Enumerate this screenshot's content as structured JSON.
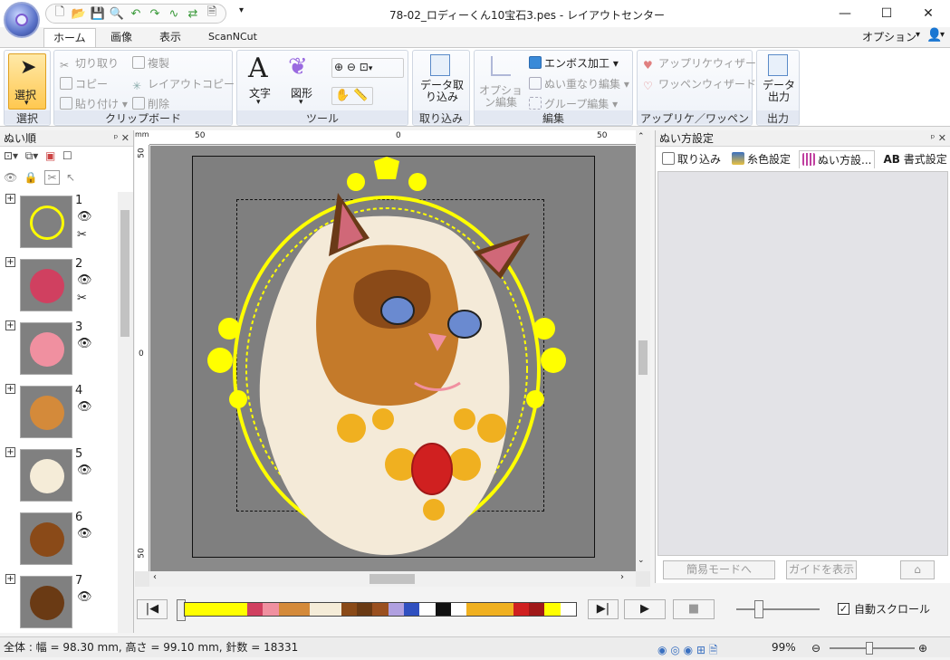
{
  "window": {
    "title": "78-02_ロディーくん10宝石3.pes - レイアウトセンター",
    "minimize": "—",
    "maximize": "☐",
    "close": "✕"
  },
  "quick_access": {
    "icons": [
      "new-file-icon",
      "open-folder-icon",
      "save-icon",
      "zoom-icon",
      "undo-icon",
      "redo-icon",
      "stitch-icon",
      "transfer-icon",
      "print-preview-icon"
    ]
  },
  "tabs": [
    "ホーム",
    "画像",
    "表示",
    "ScanNCut"
  ],
  "options_menu": "オプション",
  "ribbon": {
    "select": {
      "button": "選択",
      "group": "選択"
    },
    "clipboard": {
      "cut": "切り取り",
      "duplicate": "複製",
      "copy": "コピー",
      "layout_copy": "レイアウトコピー",
      "paste": "貼り付け",
      "delete": "削除",
      "group": "クリップボード"
    },
    "tools": {
      "text": "文字",
      "shape": "図形",
      "group": "ツール"
    },
    "import": {
      "data": "データ取り込み",
      "group": "取り込み"
    },
    "edit": {
      "options": "オプション編集",
      "emboss": "エンボス加工",
      "overlap": "ぬい重なり編集",
      "group_edit": "グループ編集",
      "group": "編集"
    },
    "applique": {
      "wizard": "アップリケウィザード",
      "patch": "ワッペンウィザード",
      "group": "アップリケ／ワッペン"
    },
    "output": {
      "data": "データ出力",
      "group": "出力"
    }
  },
  "left_pane": {
    "title": "ぬい順",
    "items": [
      {
        "num": "1",
        "visible": true,
        "cut": true
      },
      {
        "num": "2",
        "visible": true,
        "cut": true
      },
      {
        "num": "3",
        "visible": true,
        "cut": false
      },
      {
        "num": "4",
        "visible": true,
        "cut": false
      },
      {
        "num": "5",
        "visible": true,
        "cut": false
      },
      {
        "num": "6",
        "visible": true,
        "cut": false
      },
      {
        "num": "7",
        "visible": true,
        "cut": false
      }
    ]
  },
  "rulers": {
    "unit": "mm",
    "top_labels": [
      "50",
      "0",
      "50"
    ],
    "left_labels": [
      "50",
      "0",
      "50"
    ]
  },
  "right_pane": {
    "title": "ぬい方設定",
    "tabs": [
      "取り込み",
      "糸色設定",
      "ぬい方設...",
      "書式設定"
    ],
    "tab_prefix_ab": "AB",
    "easy_mode": "簡易モードへ",
    "show_guide": "ガイドを表示"
  },
  "timeline": {
    "auto_scroll_label": "自動スクロール",
    "auto_scroll_checked": true,
    "colors": [
      "#ffff00",
      "#ffff00",
      "#ffff00",
      "#ffff00",
      "#d04060",
      "#f090a0",
      "#d48a3a",
      "#d48a3a",
      "#f5ecd8",
      "#f5ecd8",
      "#8a4a18",
      "#6a3a14",
      "#9a5020",
      "#b0a0e0",
      "#3050c0",
      "#ffffff",
      "#111111",
      "#ffffff",
      "#f0b020",
      "#f0b020",
      "#f0b020",
      "#d02020",
      "#a01818",
      "#ffff00",
      "#ffffff"
    ]
  },
  "status": {
    "text": "全体 : 幅 = 98.30 mm, 高さ = 99.10 mm, 針数 = 18331",
    "zoom": "99%"
  }
}
